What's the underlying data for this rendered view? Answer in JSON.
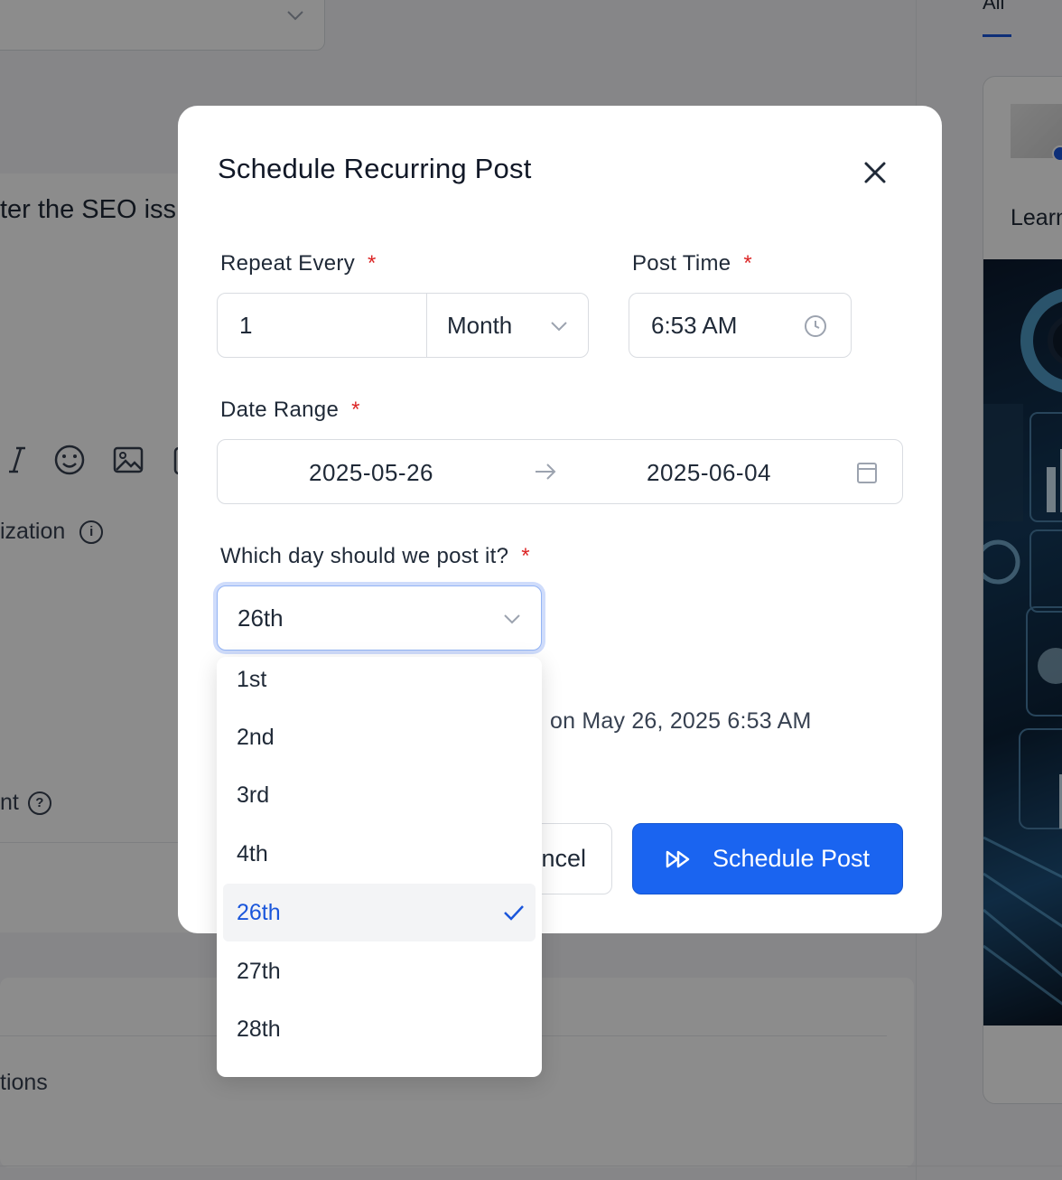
{
  "background": {
    "editor_text": "ter the SEO iss",
    "optimization_label": "ization",
    "info_glyph": "i",
    "lower_label": "nt",
    "help_glyph": "?",
    "options_label": "tions",
    "tab_label": "All",
    "preview_learn": "Learn"
  },
  "modal": {
    "title": "Schedule Recurring Post",
    "required_mark": "*",
    "repeat_every": {
      "label": "Repeat Every",
      "value": "1",
      "unit": "Month"
    },
    "post_time": {
      "label": "Post Time",
      "value": "6:53 AM"
    },
    "date_range": {
      "label": "Date Range",
      "start": "2025-05-26",
      "end": "2025-06-04"
    },
    "day_select": {
      "label": "Which day should we post it?",
      "value": "26th",
      "options": [
        {
          "label": "1st"
        },
        {
          "label": "2nd"
        },
        {
          "label": "3rd"
        },
        {
          "label": "4th"
        },
        {
          "label": "26th",
          "selected": true
        },
        {
          "label": "27th"
        },
        {
          "label": "28th"
        }
      ]
    },
    "summary_text": "on May 26, 2025 6:53 AM",
    "cancel_label": "ncel",
    "schedule_label": "Schedule Post"
  },
  "colors": {
    "primary": "#1a64f0",
    "required": "#dc2626",
    "selected_text": "#1a56db"
  }
}
